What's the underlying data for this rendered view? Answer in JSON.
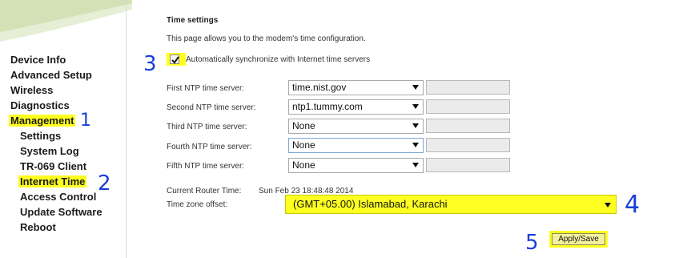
{
  "sidebar": {
    "items": [
      {
        "label": "Device Info"
      },
      {
        "label": "Advanced Setup"
      },
      {
        "label": "Wireless"
      },
      {
        "label": "Diagnostics"
      },
      {
        "label": "Management"
      }
    ],
    "subitems": [
      {
        "label": "Settings"
      },
      {
        "label": "System Log"
      },
      {
        "label": "TR-069 Client"
      },
      {
        "label": "Internet Time"
      },
      {
        "label": "Access Control"
      },
      {
        "label": "Update Software"
      },
      {
        "label": "Reboot"
      }
    ]
  },
  "main": {
    "title": "Time settings",
    "description": "This page allows you to the modem's time configuration.",
    "sync_label": "Automatically synchronize with Internet time servers",
    "sync_checked": true,
    "ntp": [
      {
        "label": "First NTP time server:",
        "value": "time.nist.gov"
      },
      {
        "label": "Second NTP time server:",
        "value": "ntp1.tummy.com"
      },
      {
        "label": "Third NTP time server:",
        "value": "None"
      },
      {
        "label": "Fourth NTP time server:",
        "value": "None"
      },
      {
        "label": "Fifth NTP time server:",
        "value": "None"
      }
    ],
    "router_time_label": "Current Router Time:",
    "router_time_value": "Sun Feb 23 18:48:48 2014",
    "tz_label": "Time zone offset:",
    "tz_value": "(GMT+05.00) Islamabad, Karachi",
    "apply_label": "Apply/Save"
  },
  "annotations": {
    "one": "1",
    "two": "2",
    "three": "3",
    "four": "4",
    "five": "5"
  },
  "colors": {
    "highlight": "#ffff22",
    "annotation_ink": "#1a3fd6"
  }
}
